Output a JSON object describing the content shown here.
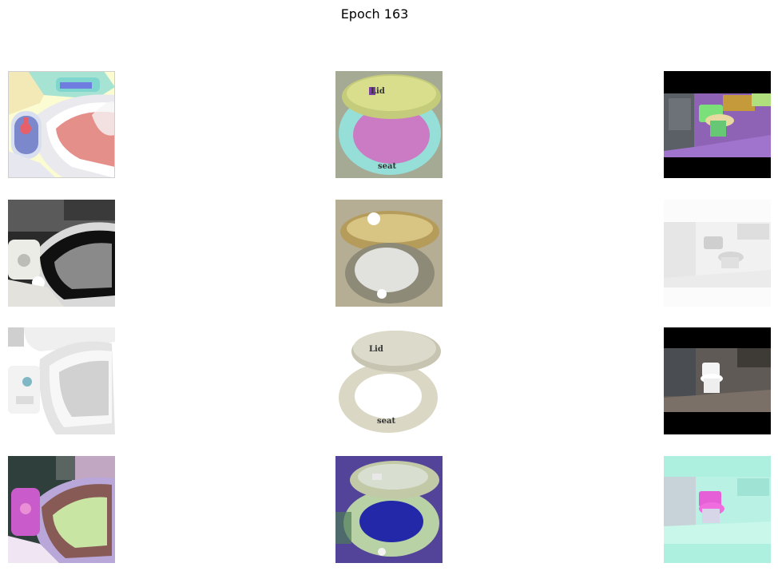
{
  "figure": {
    "title": "Epoch 163"
  }
}
